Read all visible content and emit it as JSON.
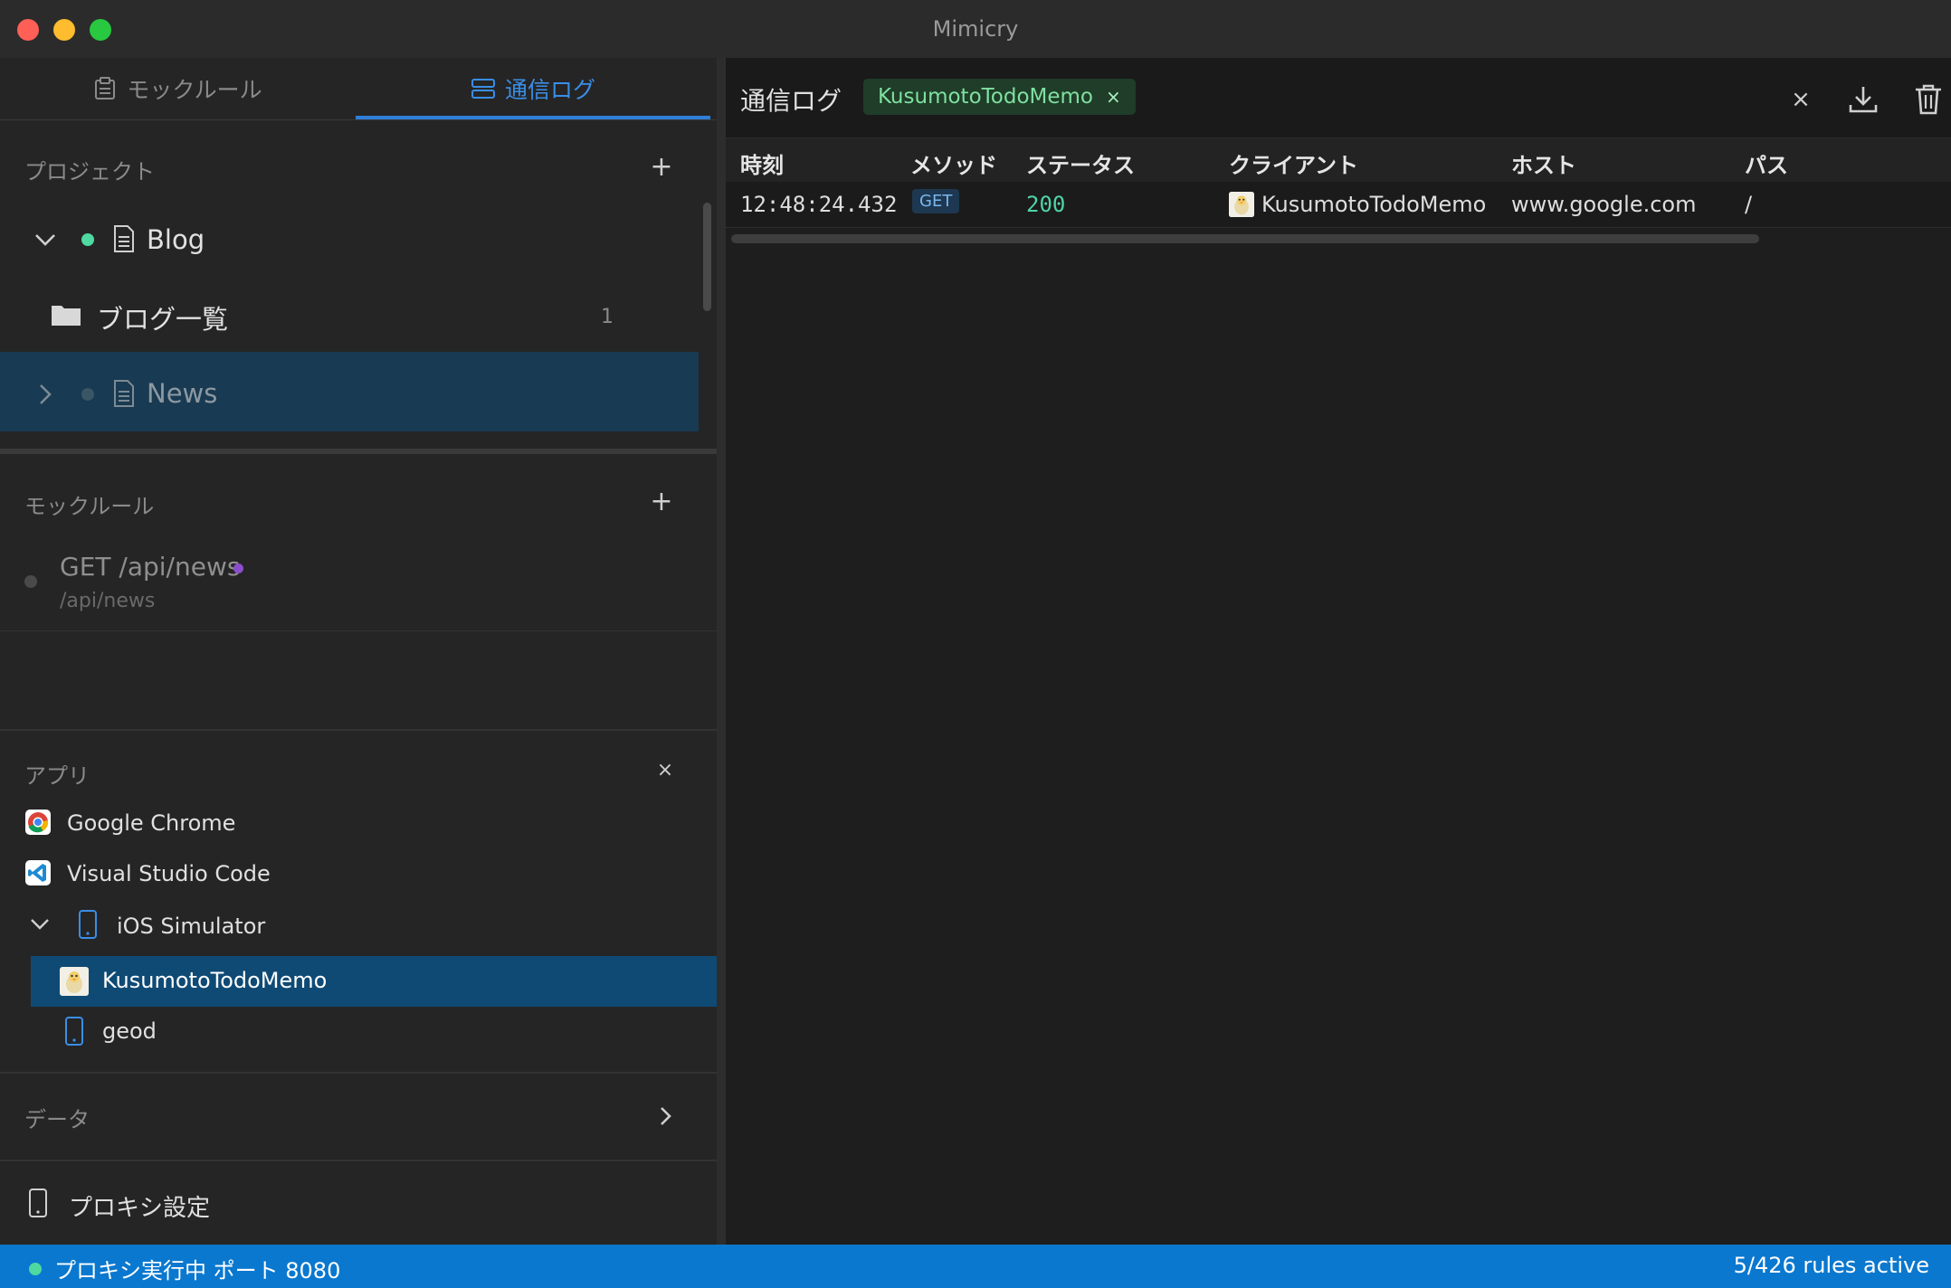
{
  "window": {
    "title": "Mimicry"
  },
  "sidebar": {
    "tabs": [
      {
        "label": "モックルール",
        "active": false
      },
      {
        "label": "通信ログ",
        "active": true
      }
    ],
    "projects": {
      "header": "プロジェクト",
      "items": [
        {
          "name": "Blog",
          "expanded": true,
          "status_color": "#4ed9a0"
        },
        {
          "name": "ブログ一覧",
          "type": "folder",
          "count": "1"
        },
        {
          "name": "News",
          "expanded": false,
          "selected": true,
          "status_color": "#3a5566"
        }
      ]
    },
    "mock_rules": {
      "header": "モックルール",
      "items": [
        {
          "title": "GET /api/news",
          "path": "/api/news",
          "indicator_color": "#8a4fc9"
        }
      ]
    },
    "apps": {
      "header": "アプリ",
      "items": [
        {
          "name": "Google Chrome",
          "icon": "chrome-icon"
        },
        {
          "name": "Visual Studio Code",
          "icon": "vscode-icon"
        },
        {
          "name": "iOS Simulator",
          "icon": "phone-icon",
          "expanded": true
        },
        {
          "name": "KusumotoTodoMemo",
          "icon": "app-icon",
          "selected": true
        },
        {
          "name": "geod",
          "icon": "phone-icon"
        }
      ]
    },
    "data_section": {
      "label": "データ"
    },
    "proxy_settings": {
      "label": "プロキシ設定"
    }
  },
  "main": {
    "title": "通信ログ",
    "filter_chip": "KusumotoTodoMemo",
    "columns": [
      "時刻",
      "メソッド",
      "ステータス",
      "クライアント",
      "ホスト",
      "パス"
    ],
    "rows": [
      {
        "time": "12:48:24.432",
        "method": "GET",
        "status": "200",
        "client": "KusumotoTodoMemo",
        "host": "www.google.com",
        "path": "/"
      }
    ]
  },
  "status_bar": {
    "left": "プロキシ実行中 ポート 8080",
    "right": "5/426 rules active"
  },
  "colors": {
    "accent": "#2f7fd8",
    "status_bar": "#0a78cf",
    "success": "#4ed9a0",
    "status_code": "#4fd4a8",
    "chip_text": "#7fe0a0"
  }
}
